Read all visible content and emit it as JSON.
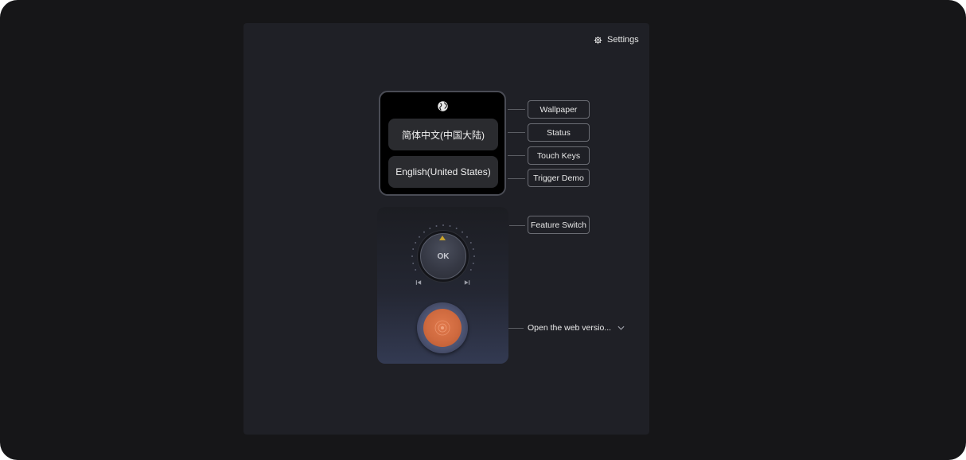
{
  "settings": {
    "label": "Settings",
    "icon": "gear-icon"
  },
  "screen": {
    "icon": "globe-icon",
    "languages": [
      "简体中文(中国大陆)",
      "English(United States)"
    ]
  },
  "tags": {
    "wallpaper": "Wallpaper",
    "status": "Status",
    "touch_keys": "Touch Keys",
    "trigger_demo": "Trigger Demo",
    "feature_switch": "Feature Switch"
  },
  "dial": {
    "label": "OK",
    "indicator_color": "#c9a42e"
  },
  "web_version": {
    "label": "Open the web versio...",
    "icon": "chevron-down-icon"
  },
  "colors": {
    "accent_orange": "#d9713f",
    "background": "#1f2026"
  }
}
